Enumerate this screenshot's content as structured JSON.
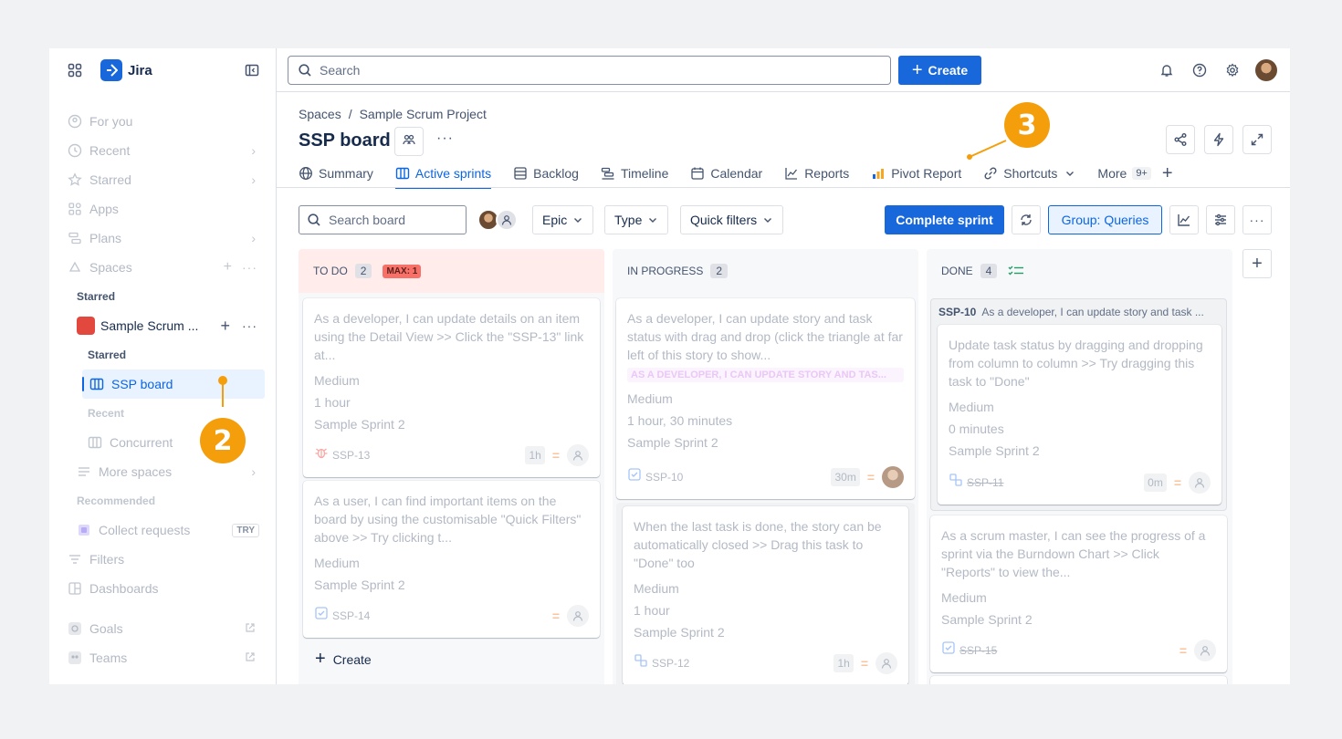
{
  "app": {
    "name": "Jira"
  },
  "sidebar": {
    "items": [
      {
        "label": "For you",
        "icon": "person-circle-icon"
      },
      {
        "label": "Recent",
        "icon": "clock-icon"
      },
      {
        "label": "Starred",
        "icon": "star-icon"
      },
      {
        "label": "Apps",
        "icon": "apps-icon"
      },
      {
        "label": "Plans",
        "icon": "plans-icon"
      },
      {
        "label": "Spaces",
        "icon": "spaces-icon"
      }
    ],
    "starred_section": "Starred",
    "project_name": "Sample Scrum ...",
    "project_starred": "Starred",
    "active_board": "SSP board",
    "recent_section": "Recent",
    "recent_item": "Concurrent",
    "more_spaces": "More spaces",
    "recommended_section": "Recommended",
    "collect_requests": "Collect requests",
    "try_badge": "TRY",
    "filters": "Filters",
    "dashboards": "Dashboards",
    "goals": "Goals",
    "teams": "Teams"
  },
  "topbar": {
    "search_placeholder": "Search",
    "create_label": "Create"
  },
  "breadcrumb": [
    "Spaces",
    "/",
    "Sample Scrum Project"
  ],
  "page_title": "SSP board",
  "title_more": "···",
  "tabs": [
    {
      "label": "Summary"
    },
    {
      "label": "Active sprints"
    },
    {
      "label": "Backlog"
    },
    {
      "label": "Timeline"
    },
    {
      "label": "Calendar"
    },
    {
      "label": "Reports"
    },
    {
      "label": "Pivot Report"
    },
    {
      "label": "Shortcuts"
    },
    {
      "label": "More",
      "badge": "9+"
    }
  ],
  "toolbar": {
    "search_placeholder": "Search board",
    "epic": "Epic",
    "type": "Type",
    "quick_filters": "Quick filters",
    "complete_sprint": "Complete sprint",
    "group": "Group: Queries",
    "more": "···"
  },
  "columns": [
    {
      "title": "TO DO",
      "count": "2",
      "max": "MAX: 1"
    },
    {
      "title": "IN PROGRESS",
      "count": "2"
    },
    {
      "title": "DONE",
      "count": "4"
    }
  ],
  "cards": {
    "c1": {
      "summary": "As a developer, I can update details on an item using the Detail View >> Click the \"SSP-13\" link at...",
      "f1": "Medium",
      "f2": "1 hour",
      "f3": "Sample Sprint 2",
      "key": "SSP-13",
      "est": "1h"
    },
    "c2": {
      "summary": "As a user, I can find important items on the board by using the customisable \"Quick Filters\" above >> Try clicking t...",
      "f1": "Medium",
      "f2": "Sample Sprint 2",
      "key": "SSP-14"
    },
    "c3": {
      "summary": "As a developer, I can update story and task status with drag and drop (click the triangle at far left of this story to show...",
      "epic": "AS A DEVELOPER, I CAN UPDATE STORY AND TAS...",
      "f1": "Medium",
      "f2": "1 hour, 30 minutes",
      "f3": "Sample Sprint 2",
      "key": "SSP-10",
      "est": "30m"
    },
    "c4": {
      "summary": "When the last task is done, the story can be automatically closed >> Drag this task to \"Done\" too",
      "f1": "Medium",
      "f2": "1 hour",
      "f3": "Sample Sprint 2",
      "key": "SSP-12",
      "est": "1h"
    },
    "parent": {
      "key": "SSP-10",
      "summary": "As a developer, I can update story and task ..."
    },
    "c5": {
      "summary": "Update task status by dragging and dropping from column to column >> Try dragging this task to \"Done\"",
      "f1": "Medium",
      "f2": "0 minutes",
      "f3": "Sample Sprint 2",
      "key": "SSP-11",
      "est": "0m"
    },
    "c6": {
      "summary": "As a scrum master, I can see the progress of a sprint via the Burndown Chart >> Click \"Reports\" to view the...",
      "f1": "Medium",
      "f2": "Sample Sprint 2",
      "key": "SSP-15"
    }
  },
  "col_create": "Create",
  "callouts": {
    "a": "2",
    "b": "3"
  },
  "colors": {
    "brand": "#1868db",
    "accent": "#f59e0b",
    "todo_bg": "#ffeceb"
  }
}
